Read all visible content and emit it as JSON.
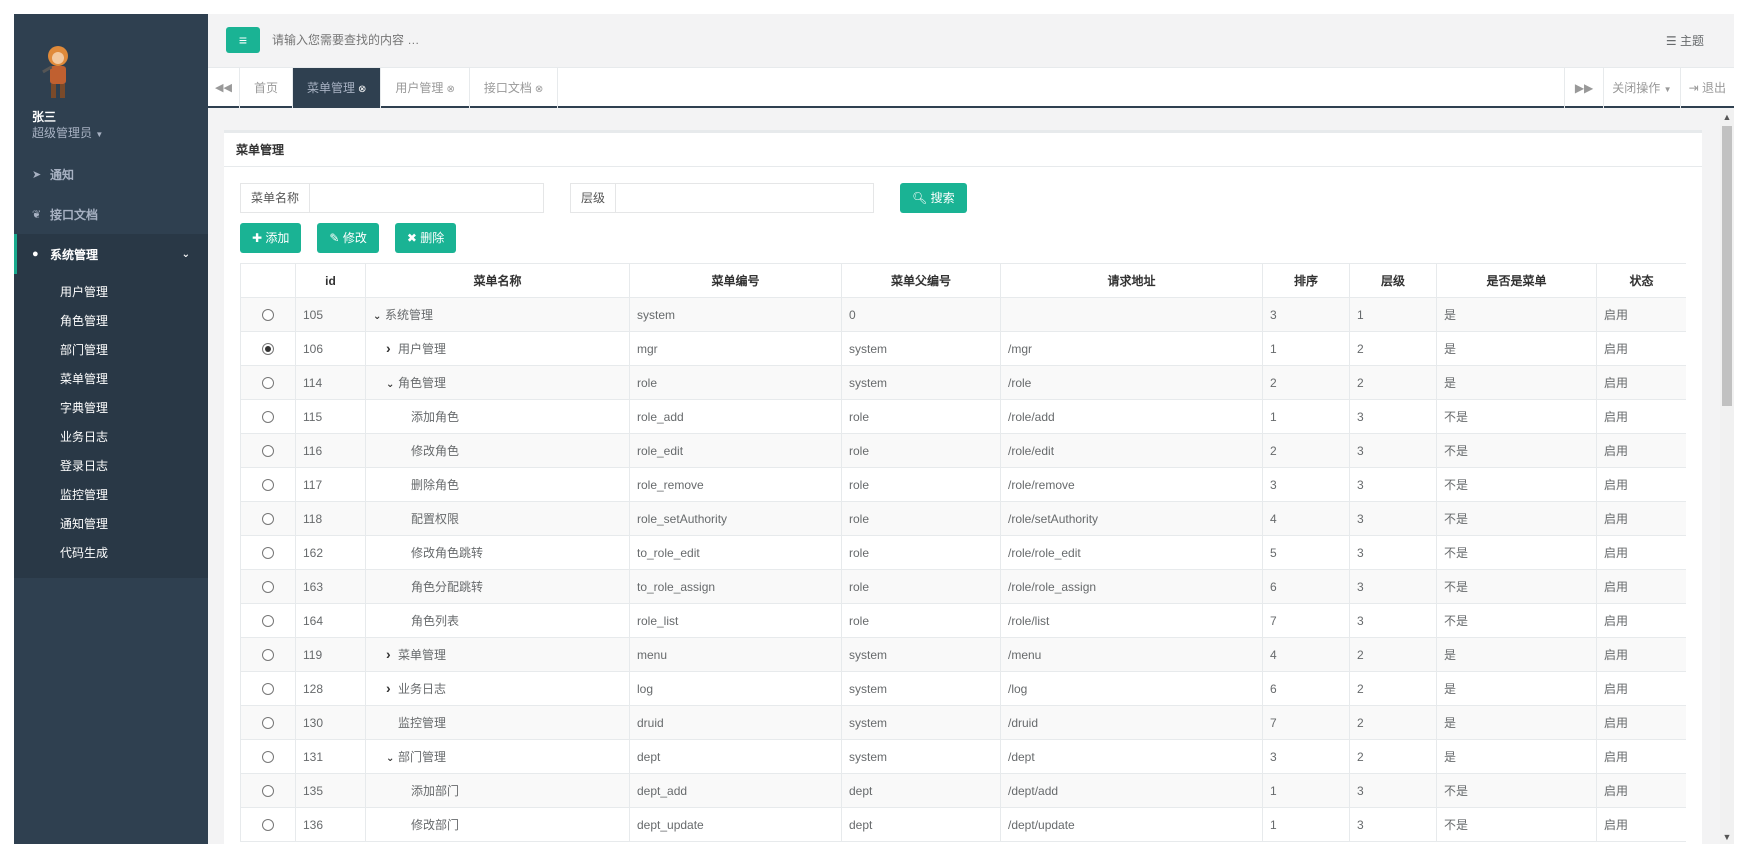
{
  "user": {
    "name": "张三",
    "role": "超级管理员"
  },
  "nav": {
    "items": [
      {
        "label": "通知",
        "icon": "paper-plane-icon"
      },
      {
        "label": "接口文档",
        "icon": "leaf-icon"
      },
      {
        "label": "系统管理",
        "icon": "user-icon"
      }
    ],
    "sub_items": [
      "用户管理",
      "角色管理",
      "部门管理",
      "菜单管理",
      "字典管理",
      "业务日志",
      "登录日志",
      "监控管理",
      "通知管理",
      "代码生成"
    ]
  },
  "topbar": {
    "search_placeholder": "请输入您需要查找的内容 …",
    "theme_label": "主题"
  },
  "tabs": {
    "items": [
      {
        "label": "首页"
      },
      {
        "label": "菜单管理"
      },
      {
        "label": "用户管理"
      },
      {
        "label": "接口文档"
      }
    ],
    "close_ops": "关闭操作",
    "logout": "退出"
  },
  "panel": {
    "title": "菜单管理",
    "filter_menu_name_label": "菜单名称",
    "filter_level_label": "层级",
    "search_button": "搜索",
    "add_button": "添加",
    "edit_button": "修改",
    "delete_button": "删除"
  },
  "table": {
    "headers": [
      "id",
      "菜单名称",
      "菜单编号",
      "菜单父编号",
      "请求地址",
      "排序",
      "层级",
      "是否是菜单",
      "状态"
    ],
    "rows": [
      {
        "id": "105",
        "name": "系统管理",
        "code": "system",
        "pcode": "0",
        "url": "",
        "num": "3",
        "level": "1",
        "ismenu": "是",
        "status": "启用",
        "indent": 0,
        "toggle": "open",
        "selected": false
      },
      {
        "id": "106",
        "name": "用户管理",
        "code": "mgr",
        "pcode": "system",
        "url": "/mgr",
        "num": "1",
        "level": "2",
        "ismenu": "是",
        "status": "启用",
        "indent": 1,
        "toggle": "closed",
        "selected": true
      },
      {
        "id": "114",
        "name": "角色管理",
        "code": "role",
        "pcode": "system",
        "url": "/role",
        "num": "2",
        "level": "2",
        "ismenu": "是",
        "status": "启用",
        "indent": 1,
        "toggle": "open",
        "selected": false
      },
      {
        "id": "115",
        "name": "添加角色",
        "code": "role_add",
        "pcode": "role",
        "url": "/role/add",
        "num": "1",
        "level": "3",
        "ismenu": "不是",
        "status": "启用",
        "indent": 2,
        "toggle": "none",
        "selected": false
      },
      {
        "id": "116",
        "name": "修改角色",
        "code": "role_edit",
        "pcode": "role",
        "url": "/role/edit",
        "num": "2",
        "level": "3",
        "ismenu": "不是",
        "status": "启用",
        "indent": 2,
        "toggle": "none",
        "selected": false
      },
      {
        "id": "117",
        "name": "删除角色",
        "code": "role_remove",
        "pcode": "role",
        "url": "/role/remove",
        "num": "3",
        "level": "3",
        "ismenu": "不是",
        "status": "启用",
        "indent": 2,
        "toggle": "none",
        "selected": false
      },
      {
        "id": "118",
        "name": "配置权限",
        "code": "role_setAuthority",
        "pcode": "role",
        "url": "/role/setAuthority",
        "num": "4",
        "level": "3",
        "ismenu": "不是",
        "status": "启用",
        "indent": 2,
        "toggle": "none",
        "selected": false
      },
      {
        "id": "162",
        "name": "修改角色跳转",
        "code": "to_role_edit",
        "pcode": "role",
        "url": "/role/role_edit",
        "num": "5",
        "level": "3",
        "ismenu": "不是",
        "status": "启用",
        "indent": 2,
        "toggle": "none",
        "selected": false
      },
      {
        "id": "163",
        "name": "角色分配跳转",
        "code": "to_role_assign",
        "pcode": "role",
        "url": "/role/role_assign",
        "num": "6",
        "level": "3",
        "ismenu": "不是",
        "status": "启用",
        "indent": 2,
        "toggle": "none",
        "selected": false
      },
      {
        "id": "164",
        "name": "角色列表",
        "code": "role_list",
        "pcode": "role",
        "url": "/role/list",
        "num": "7",
        "level": "3",
        "ismenu": "不是",
        "status": "启用",
        "indent": 2,
        "toggle": "none",
        "selected": false
      },
      {
        "id": "119",
        "name": "菜单管理",
        "code": "menu",
        "pcode": "system",
        "url": "/menu",
        "num": "4",
        "level": "2",
        "ismenu": "是",
        "status": "启用",
        "indent": 1,
        "toggle": "closed",
        "selected": false
      },
      {
        "id": "128",
        "name": "业务日志",
        "code": "log",
        "pcode": "system",
        "url": "/log",
        "num": "6",
        "level": "2",
        "ismenu": "是",
        "status": "启用",
        "indent": 1,
        "toggle": "closed",
        "selected": false
      },
      {
        "id": "130",
        "name": "监控管理",
        "code": "druid",
        "pcode": "system",
        "url": "/druid",
        "num": "7",
        "level": "2",
        "ismenu": "是",
        "status": "启用",
        "indent": 1,
        "toggle": "none",
        "selected": false
      },
      {
        "id": "131",
        "name": "部门管理",
        "code": "dept",
        "pcode": "system",
        "url": "/dept",
        "num": "3",
        "level": "2",
        "ismenu": "是",
        "status": "启用",
        "indent": 1,
        "toggle": "open",
        "selected": false
      },
      {
        "id": "135",
        "name": "添加部门",
        "code": "dept_add",
        "pcode": "dept",
        "url": "/dept/add",
        "num": "1",
        "level": "3",
        "ismenu": "不是",
        "status": "启用",
        "indent": 2,
        "toggle": "none",
        "selected": false
      },
      {
        "id": "136",
        "name": "修改部门",
        "code": "dept_update",
        "pcode": "dept",
        "url": "/dept/update",
        "num": "1",
        "level": "3",
        "ismenu": "不是",
        "status": "启用",
        "indent": 2,
        "toggle": "none",
        "selected": false
      }
    ]
  },
  "colors": {
    "accent": "#1ab394",
    "sidebar": "#2f4050",
    "sidebar_active": "#293846"
  }
}
